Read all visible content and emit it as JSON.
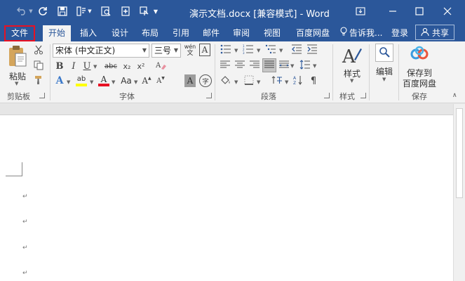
{
  "window": {
    "title": "演示文档.docx [兼容模式] - Word"
  },
  "tabs": {
    "file": "文件",
    "home": "开始",
    "insert": "插入",
    "design": "设计",
    "layout": "布局",
    "references": "引用",
    "mailings": "邮件",
    "review": "审阅",
    "view": "视图",
    "baidu": "百度网盘",
    "tell_me": "告诉我...",
    "login": "登录",
    "share": "共享"
  },
  "ribbon": {
    "clipboard": {
      "paste": "粘贴",
      "group_label": "剪贴板"
    },
    "font": {
      "font_name": "宋体 (中文正文)",
      "font_size": "三号",
      "phonetic_glyph": "wén",
      "border_char_glyph": "A",
      "bold": "B",
      "italic": "I",
      "underline": "U",
      "strike": "abc",
      "subscript": "x₂",
      "superscript": "x²",
      "grow": "A",
      "shrink": "A",
      "change_case": "Aa",
      "shade_char": "A",
      "enclose": "字",
      "highlight": "ab",
      "font_color": "A",
      "text_effect": "A",
      "group_label": "字体"
    },
    "paragraph": {
      "group_label": "段落"
    },
    "styles": {
      "label": "样式",
      "group_label": "样式"
    },
    "editing": {
      "label": "编辑"
    },
    "save": {
      "label_line1": "保存到",
      "label_line2": "百度网盘",
      "group_label": "保存"
    }
  },
  "colors": {
    "title_bar": "#2b579a",
    "ribbon_bg": "#f3f3f3",
    "file_tab_outline": "#e81123",
    "highlight_yellow": "#ffff00",
    "font_color_red": "#e81123"
  },
  "document": {
    "paragraph_mark": "↵"
  }
}
